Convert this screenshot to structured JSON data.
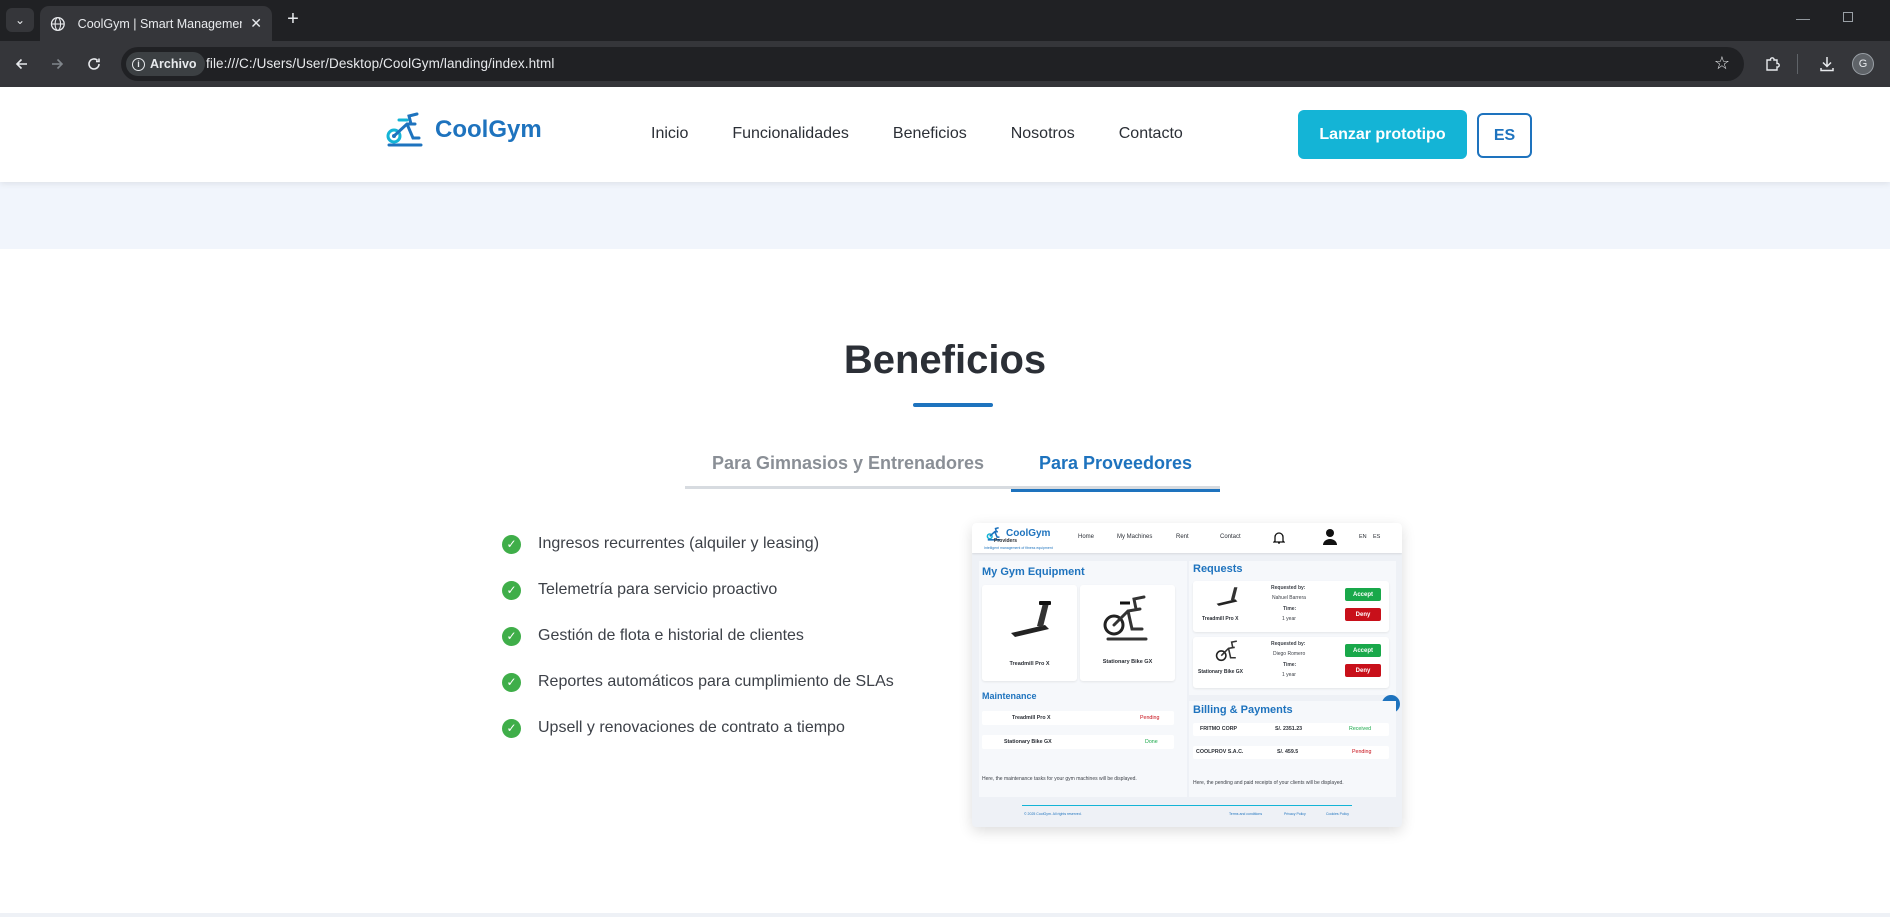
{
  "browser": {
    "tab_title": "CoolGym | Smart Management",
    "chip_label": "Archivo",
    "url": "file:///C:/Users/User/Desktop/CoolGym/landing/index.html",
    "profile_initial": "G"
  },
  "header": {
    "brand": "CoolGym",
    "nav": [
      "Inicio",
      "Funcionalidades",
      "Beneficios",
      "Nosotros",
      "Contacto"
    ],
    "cta": "Lanzar prototipo",
    "lang": "ES"
  },
  "benefits": {
    "title": "Beneficios",
    "tabs": [
      "Para Gimnasios y Entrenadores",
      "Para Proveedores"
    ],
    "active_tab": "Para Proveedores",
    "items": [
      "Ingresos recurrentes (alquiler y leasing)",
      "Telemetría para servicio proactivo",
      "Gestión de flota e historial de clientes",
      "Reportes automáticos para cumplimiento de SLAs",
      "Upsell y renovaciones de contrato a tiempo"
    ]
  },
  "mockup": {
    "brand": "CoolGym",
    "brand_sub": "Providers",
    "tagline": "Intelligent management of fitness equipment",
    "nav": [
      "Home",
      "My Machines",
      "Rent",
      "Contact"
    ],
    "langs": [
      "EN",
      "ES"
    ],
    "equipment": {
      "title": "My Gym Equipment",
      "items": [
        "Treadmill Pro X",
        "Stationary Bike GX"
      ]
    },
    "maintenance": {
      "title": "Maintenance",
      "rows": [
        {
          "name": "Treadmill Pro X",
          "status": "Pending"
        },
        {
          "name": "Stationary Bike GX",
          "status": "Done"
        }
      ],
      "note": "Here, the maintenance tasks for your gym machines will be displayed."
    },
    "requests": {
      "title": "Requests",
      "requested_by_label": "Requested by:",
      "time_label": "Time:",
      "accept": "Accept",
      "deny": "Deny",
      "rows": [
        {
          "machine": "Treadmill Pro X",
          "requester": "Nahuel Barrera",
          "time": "1 year"
        },
        {
          "machine": "Stationary Bike GX",
          "requester": "Diego Romero",
          "time": "1 year"
        }
      ]
    },
    "billing": {
      "title": "Billing & Payments",
      "rows": [
        {
          "client": "FRITMO CORP",
          "amount": "S/. 2351.23",
          "status": "Received"
        },
        {
          "client": "COOLPROV S.A.C.",
          "amount": "S/. 459.5",
          "status": "Pending"
        }
      ],
      "note": "Here, the pending and paid receipts of your clients will be displayed."
    },
    "footer": {
      "copyright": "© 2025 CoolGym. All rights reserved.",
      "links": [
        "Terms and conditions",
        "Privacy Policy",
        "Cookies Policy"
      ]
    }
  },
  "colors": {
    "brand_blue": "#1e73be",
    "cta_cyan": "#14b4d6",
    "check_green": "#3fae49",
    "accept_green": "#19a84a",
    "deny_red": "#c8101a"
  }
}
